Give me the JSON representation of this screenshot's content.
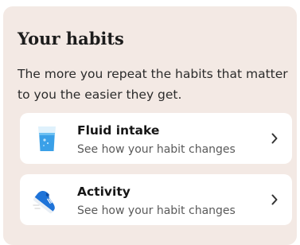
{
  "section": {
    "title": "Your habits",
    "subtitle": "The more you repeat the habits that matter to you the easier they get."
  },
  "habits": [
    {
      "name": "Fluid intake",
      "description": "See how your habit changes",
      "icon": "water-glass-icon"
    },
    {
      "name": "Activity",
      "description": "See how your habit changes",
      "icon": "running-shoe-icon"
    }
  ],
  "colors": {
    "card_background": "#f3e9e4",
    "item_background": "#ffffff",
    "water_blue": "#3aa0e8",
    "shoe_blue": "#1e73d8"
  }
}
